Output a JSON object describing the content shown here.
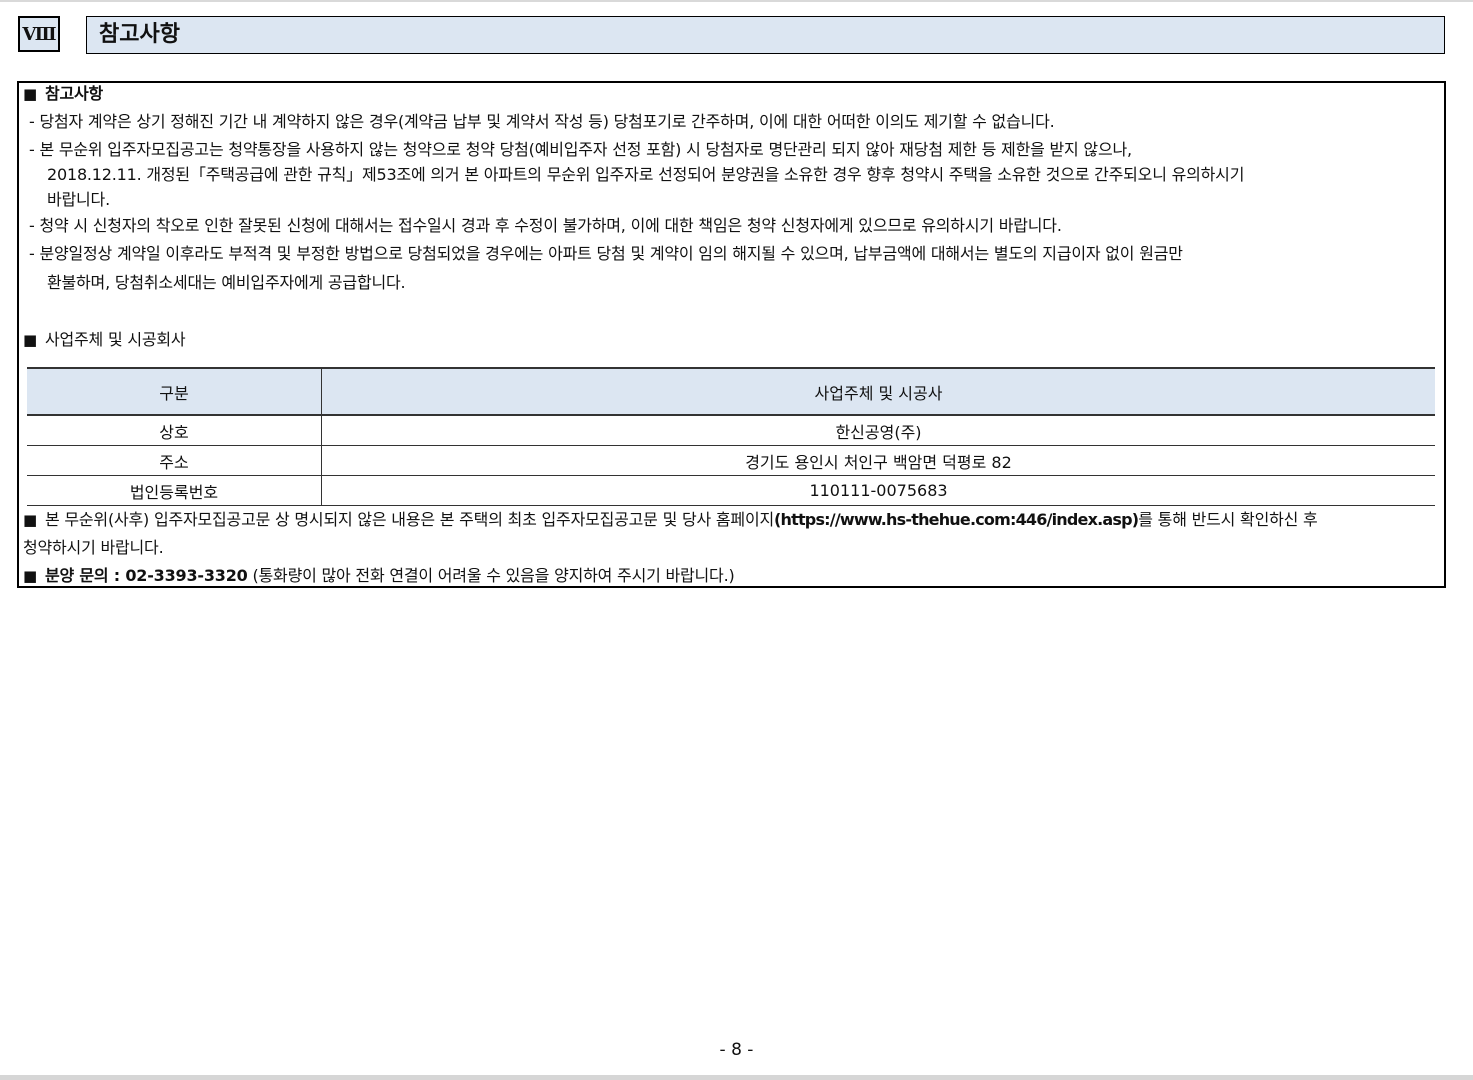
{
  "header": {
    "section_number": "Ⅷ",
    "section_title": "참고사항"
  },
  "notes": {
    "heading": "참고사항",
    "lines": [
      "- 당첨자 계약은 상기 정해진 기간 내 계약하지 않은 경우(계약금 납부 및 계약서 작성 등) 당첨포기로 간주하며, 이에 대한 어떠한 이의도 제기할 수 없습니다.",
      "- 본 무순위 입주자모집공고는 청약통장을 사용하지 않는 청약으로 청약 당첨(예비입주자 선정 포함) 시 당첨자로 명단관리 되지 않아 재당첨 제한 등 제한을 받지 않으나,",
      "2018.12.11. 개정된「주택공급에 관한 규칙」제53조에 의거 본 아파트의 무순위 입주자로 선정되어 분양권을 소유한 경우 향후 청약시 주택을 소유한 것으로 간주되오니 유의하시기",
      "바랍니다.",
      "- 청약 시 신청자의 착오로 인한 잘못된 신청에 대해서는 접수일시 경과 후 수정이 불가하며, 이에 대한 책임은 청약 신청자에게 있으므로 유의하시기 바랍니다.",
      "- 분양일정상 계약일 이후라도 부적격 및 부정한 방법으로 당첨되었을 경우에는 아파트 당첨 및 계약이 임의 해지될 수 있으며, 납부금액에 대해서는 별도의 지급이자 없이 원금만",
      "환불하며, 당첨취소세대는 예비입주자에게 공급합니다."
    ]
  },
  "company": {
    "heading": "사업주체 및 시공회사",
    "table": {
      "headers": [
        "구분",
        "사업주체 및 시공사"
      ],
      "rows": [
        [
          "상호",
          "한신공영(주)"
        ],
        [
          "주소",
          "경기도 용인시 처인구 백암면 덕평로 82"
        ],
        [
          "법인등록번호",
          "110111-0075683"
        ]
      ]
    }
  },
  "footer_note": {
    "part1": "본 무순위(사후) 입주자모집공고문 상 명시되지 않은 내용은 본 주택의 최초 입주자모집공고문 및 당사 홈페이지",
    "url": "(https://www.hs-thehue.com:446/index.asp)",
    "part2": "를 통해 반드시 확인하신 후",
    "part3": "청약하시기 바랍니다."
  },
  "inquiry": {
    "label": "분양 문의 : 02-3393-3320",
    "note": "(통화량이 많아 전화 연결이 어려울 수 있음을 양지하여 주시기 바랍니다.)"
  },
  "page_number": "- 8 -"
}
